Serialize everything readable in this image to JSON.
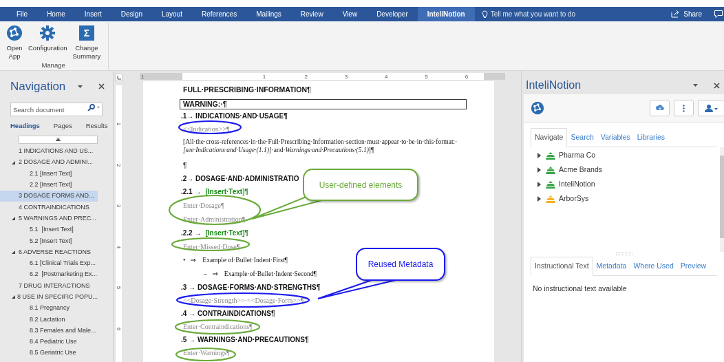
{
  "menu_tabs": [
    {
      "label": "File",
      "selected": false
    },
    {
      "label": "Home",
      "selected": false
    },
    {
      "label": "Insert",
      "selected": false
    },
    {
      "label": "Design",
      "selected": false
    },
    {
      "label": "Layout",
      "selected": false
    },
    {
      "label": "References",
      "selected": false
    },
    {
      "label": "Mailings",
      "selected": false
    },
    {
      "label": "Review",
      "selected": false
    },
    {
      "label": "View",
      "selected": false
    },
    {
      "label": "Developer",
      "selected": false
    },
    {
      "label": "InteliNotion",
      "selected": true
    }
  ],
  "tell_me": {
    "placeholder": "Tell me what you want to do"
  },
  "share": "Share",
  "ribbon": {
    "buttons": [
      {
        "kind": "app",
        "label": "Open App"
      },
      {
        "kind": "gear",
        "label": "Configuration"
      },
      {
        "kind": "sigma",
        "label": "Change Summary",
        "icon_text": "Σ"
      }
    ],
    "group": "Manage"
  },
  "navigation": {
    "title": "Navigation",
    "search": {
      "placeholder": "Search document"
    },
    "tabs": [
      {
        "label": "Headings",
        "selected": true
      },
      {
        "label": "Pages",
        "selected": false
      },
      {
        "label": "Results",
        "selected": false
      }
    ],
    "headings": [
      {
        "label": "1 INDICATIONS AND US...",
        "selected": false
      },
      {
        "label": "2 DOSAGE AND ADMINI...",
        "selected": false,
        "expanded": true,
        "children": [
          {
            "label": "2.1 [Insert Text]",
            "selected": false
          },
          {
            "label": "2.2 [Insert Text]",
            "selected": false
          }
        ]
      },
      {
        "label": "3 DOSAGE FORMS AND...",
        "selected": true
      },
      {
        "label": "4 CONTRAINDICATIONS",
        "selected": false
      },
      {
        "label": "5 WARNINGS AND PREC...",
        "selected": false,
        "expanded": true,
        "children": [
          {
            "label": "5.1  [Insert Text]",
            "selected": false
          },
          {
            "label": "5.2 [Insert Text]",
            "selected": false
          }
        ]
      },
      {
        "label": "6 ADVERSE REACTIONS",
        "selected": false,
        "expanded": true,
        "children": [
          {
            "label": "6.1 [Clinical Trials Exp...",
            "selected": false
          },
          {
            "label": "6.2  [Postmarketing Ex...",
            "selected": false
          }
        ]
      },
      {
        "label": "7 DRUG INTERACTIONS",
        "selected": false
      },
      {
        "label": "8 USE IN SPECIFIC POPU...",
        "selected": false,
        "expanded": true,
        "children": [
          {
            "label": "8.1 Pregnancy",
            "selected": false
          },
          {
            "label": "8.2 Lactation",
            "selected": false
          },
          {
            "label": "8.3 Females and Male...",
            "selected": false
          },
          {
            "label": "8.4 Pediatric Use",
            "selected": false
          },
          {
            "label": "8.5 Geriatric Use",
            "selected": false
          }
        ]
      }
    ]
  },
  "rulers": {
    "horizontal": [
      "1",
      "1",
      "2",
      "3",
      "4",
      "5",
      "6"
    ],
    "vertical": [
      "1",
      "2",
      "3",
      "4",
      "5",
      "6"
    ]
  },
  "document": {
    "lines": [
      {
        "kind": "title",
        "text": "FULL·PRESCRIBING·INFORMATION¶"
      },
      {
        "kind": "boxed",
        "text": "WARNING:·¶"
      },
      {
        "kind": "heading",
        "number": ".1→",
        "text": "INDICATIONS·AND·USAGE¶"
      },
      {
        "kind": "placeholder",
        "text": "<<Indication>>¶"
      },
      {
        "kind": "body",
        "text": "[All·the·cross-references·in·the·Full·Prescribing·Information·section·must·appear·to·be·in·this·format:·*[see·Indications·and·Usage·(1.1)]*·and·*Warnings·and·Precautions·(5.1)*]¶"
      },
      {
        "kind": "blank",
        "text": "¶"
      },
      {
        "kind": "heading",
        "number": ".2→",
        "text": "DOSAGE·AND·ADMINISTRATIO"
      },
      {
        "kind": "heading-insert",
        "number": ".2.1 →",
        "text": "[Insert·Text]¶"
      },
      {
        "kind": "placeholder",
        "text": "Enter·Dosage¶"
      },
      {
        "kind": "placeholder",
        "text": "Enter·Administration¶"
      },
      {
        "kind": "heading-insert",
        "number": ".2.2 →",
        "text": "[Insert·Text]¶"
      },
      {
        "kind": "placeholder",
        "text": "Enter·Missed·Dose¶"
      },
      {
        "kind": "bullet",
        "marker": "•",
        "text": "Example·of·Bullet·Indent·First¶"
      },
      {
        "kind": "subbullet",
        "marker": "–",
        "text": "Example·of·Bullet·Indent·Second¶"
      },
      {
        "kind": "heading",
        "number": ".3 →",
        "text": "DOSAGE·FORMS·AND·STRENGTHS¶"
      },
      {
        "kind": "placeholder",
        "text": "<<Dosage·Strength>>·<<Dosage·Form>>¶"
      },
      {
        "kind": "heading",
        "number": ".4 →",
        "text": "CONTRAINDICATIONS¶"
      },
      {
        "kind": "placeholder",
        "text": "Enter·Contraindications¶"
      },
      {
        "kind": "heading",
        "number": ".5 →",
        "text": "WARNINGS·AND·PRECAUTIONS¶"
      },
      {
        "kind": "placeholder",
        "text": "Enter·Warnings¶"
      }
    ]
  },
  "annotations": [
    {
      "text": "User-defined elements",
      "color": "#6aaa3a"
    },
    {
      "text": "Reused Metadata",
      "color": "#1a1aee"
    }
  ],
  "side_panel": {
    "title": "InteliNotion",
    "tabs": [
      {
        "label": "Navigate",
        "selected": true
      },
      {
        "label": "Search",
        "selected": false
      },
      {
        "label": "Variables",
        "selected": false
      },
      {
        "label": "Libraries",
        "selected": false
      }
    ],
    "tree": [
      {
        "label": "Pharma Co",
        "color": "#3aa64a",
        "expanded": false
      },
      {
        "label": "Acme Brands",
        "color": "#3aa64a",
        "expanded": false
      },
      {
        "label": "InteliNotion",
        "color": "#3aa64a",
        "expanded": false
      },
      {
        "label": "ArborSys",
        "color": "#f5b324",
        "expanded": false
      }
    ],
    "detail_tabs": [
      {
        "label": "Instructional Text",
        "selected": true
      },
      {
        "label": "Metadata",
        "selected": false
      },
      {
        "label": "Where Used",
        "selected": false
      },
      {
        "label": "Preview",
        "selected": false
      }
    ],
    "message": "No instructional text available"
  }
}
